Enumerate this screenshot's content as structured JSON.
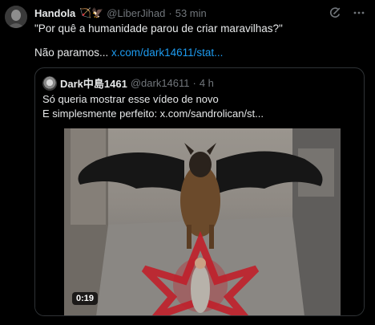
{
  "tweet": {
    "author_name": "Handola",
    "author_emoji": "🏹🦅",
    "handle": "@LiberJihad",
    "separator": "·",
    "time": "53 min",
    "text_line1": "\"Por quê a humanidade parou de criar maravilhas?\"",
    "text_line2_prefix": "Não paramos... ",
    "text_line2_link": "x.com/dark14611/stat...",
    "icons": [
      "grok-icon",
      "more-icon"
    ]
  },
  "quote": {
    "author_name": "Dark中島1461",
    "handle": "@dark14611",
    "separator": "·",
    "time": "4 h",
    "text_line1": "Só queria mostrar esse vídeo de novo",
    "text_line2": "E simplesmente perfeito:  x.com/sandrolican/st...",
    "video": {
      "duration": "0:19"
    }
  },
  "colors": {
    "background": "#000000",
    "text": "#e7e9ea",
    "muted": "#71767b",
    "link": "#1d9bf0",
    "border": "#2f3336"
  }
}
